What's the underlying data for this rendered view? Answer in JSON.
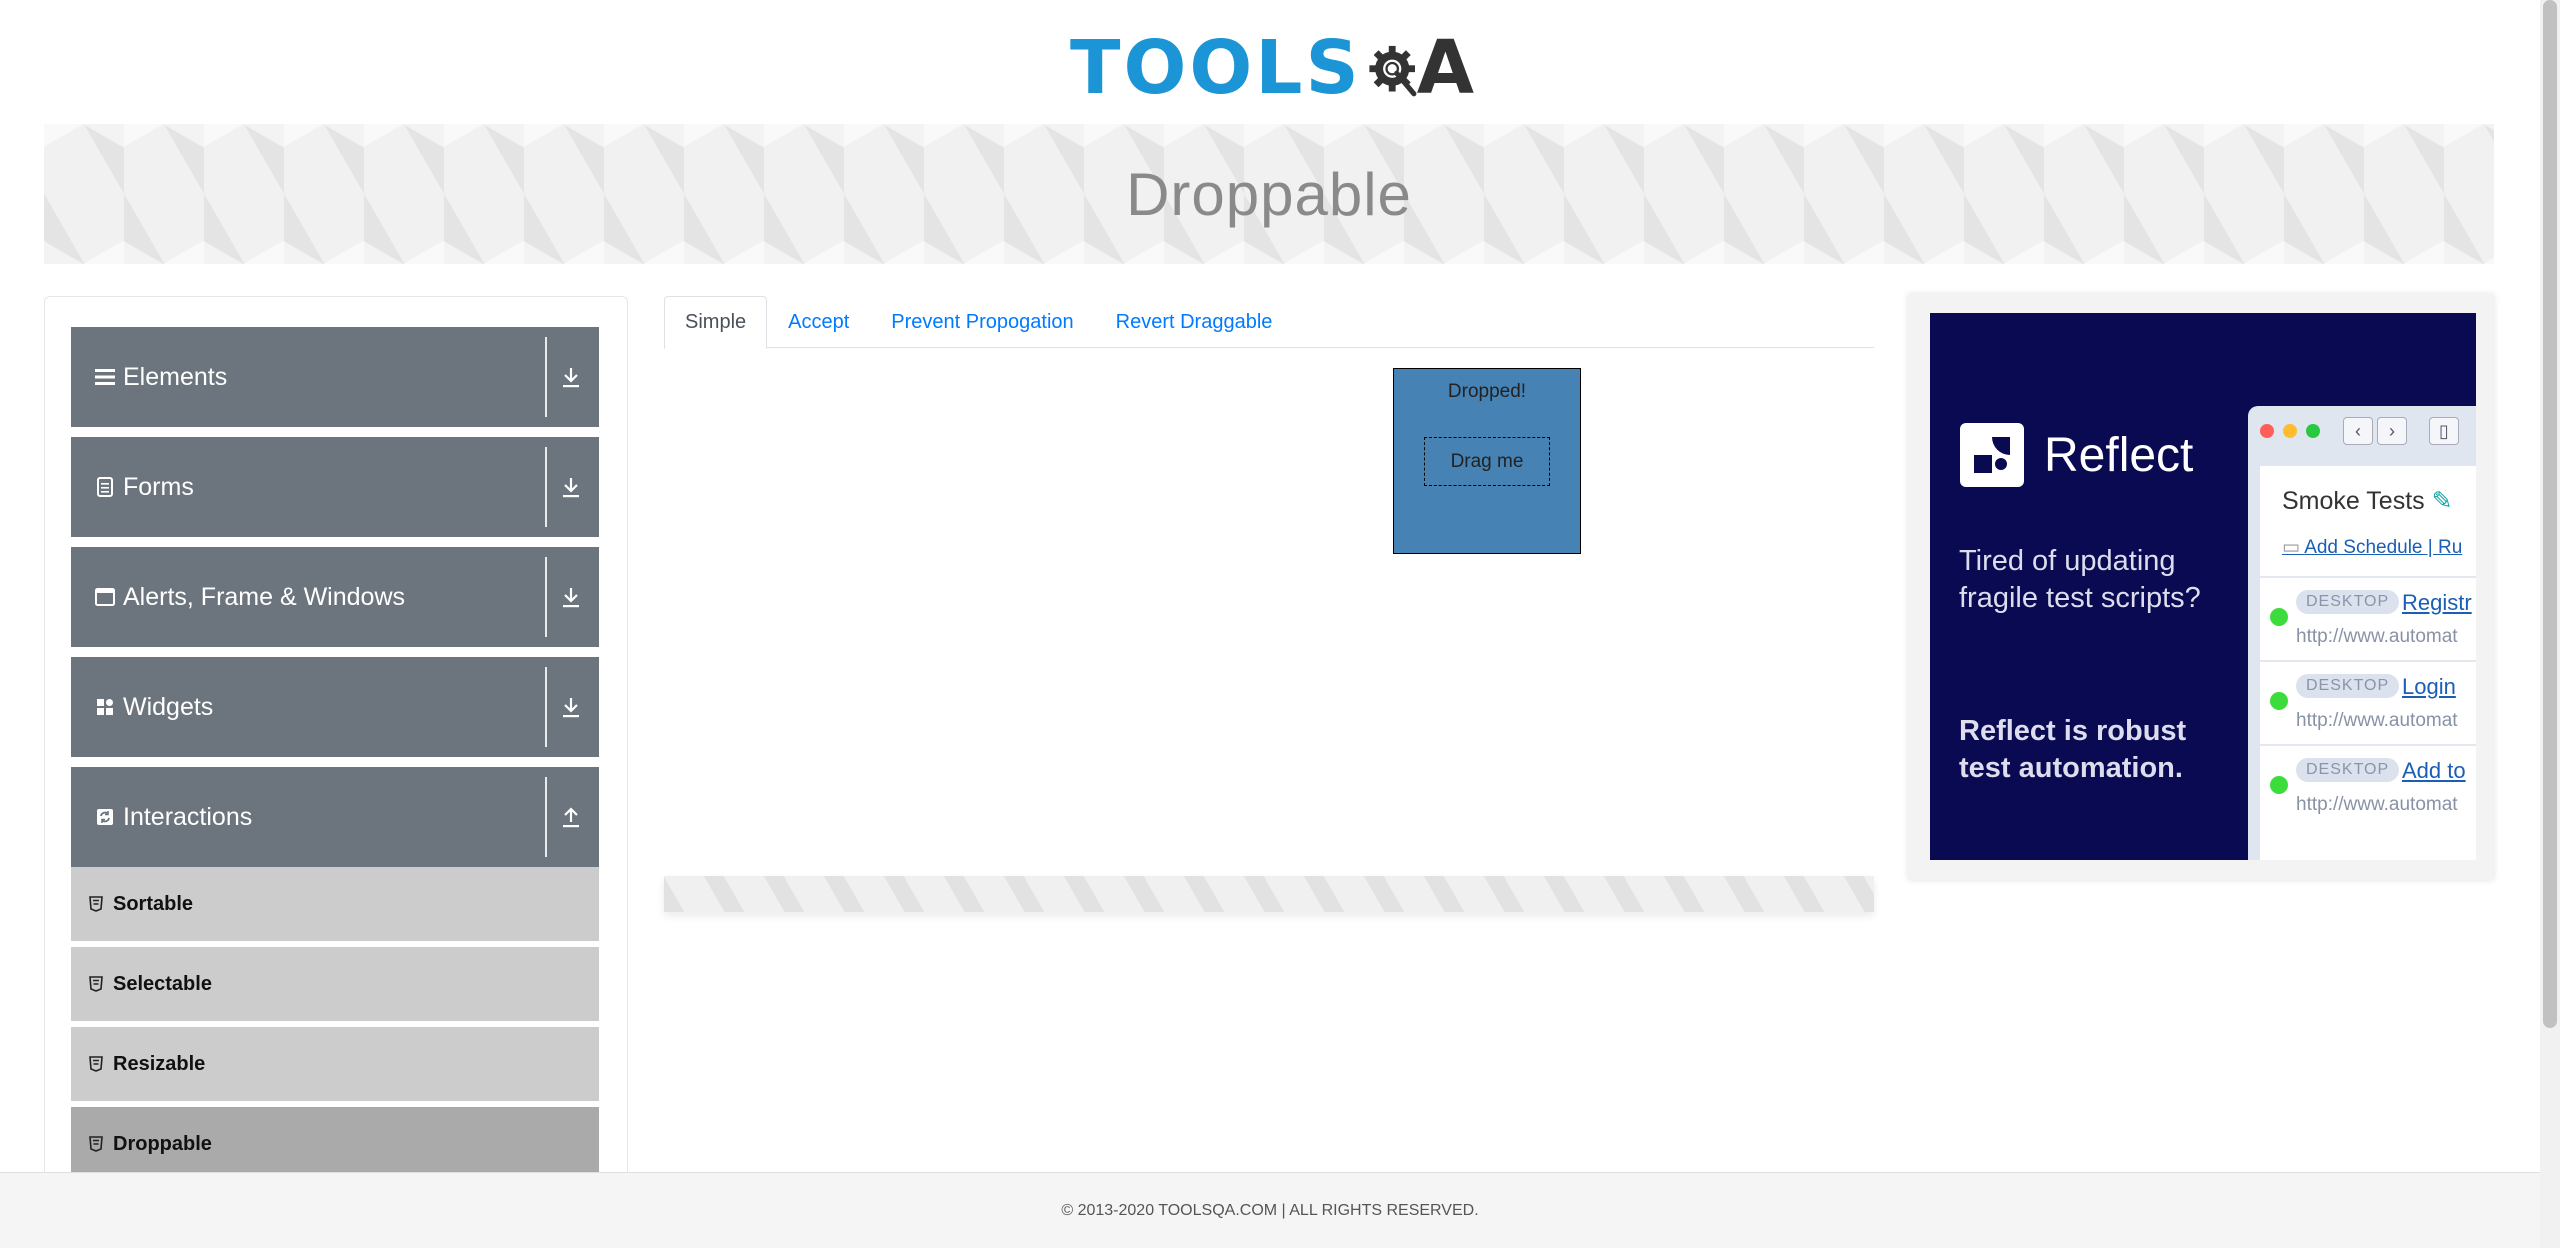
{
  "header": {
    "logo_text_left": "TOOLS",
    "logo_text_right": "A",
    "page_title": "Droppable"
  },
  "sidebar": {
    "groups": [
      {
        "label": "Elements",
        "icon": "hamburger-icon",
        "expanded": false
      },
      {
        "label": "Forms",
        "icon": "document-icon",
        "expanded": false
      },
      {
        "label": "Alerts, Frame & Windows",
        "icon": "window-icon",
        "expanded": false
      },
      {
        "label": "Widgets",
        "icon": "widgets-icon",
        "expanded": false
      },
      {
        "label": "Interactions",
        "icon": "refresh-icon",
        "expanded": true
      }
    ],
    "interaction_items": [
      {
        "label": "Sortable",
        "active": false
      },
      {
        "label": "Selectable",
        "active": false
      },
      {
        "label": "Resizable",
        "active": false
      },
      {
        "label": "Droppable",
        "active": true
      }
    ]
  },
  "tabs": [
    {
      "label": "Simple",
      "active": true
    },
    {
      "label": "Accept",
      "active": false
    },
    {
      "label": "Prevent Propogation",
      "active": false
    },
    {
      "label": "Revert Draggable",
      "active": false
    }
  ],
  "demo": {
    "drop_text": "Dropped!",
    "drag_text": "Drag me",
    "drop_color": "#4682b4"
  },
  "ad": {
    "brand": "Reflect",
    "headline": "Tired of updating fragile test scripts?",
    "tagline": "Reflect is robust test automation.",
    "mock_title": "Smoke Tests",
    "mock_links": "Add Schedule  |  Ru",
    "rows": [
      {
        "badge": "DESKTOP",
        "link": "Registr",
        "url": "http://www.automat"
      },
      {
        "badge": "DESKTOP",
        "link": "Login",
        "url": "http://www.automat"
      },
      {
        "badge": "DESKTOP",
        "link": "Add to",
        "url": "http://www.automat"
      }
    ]
  },
  "footer": {
    "text": "© 2013-2020 TOOLSQA.COM | ALL RIGHTS RESERVED."
  },
  "colors": {
    "brand_blue": "#1b95d6",
    "menu_gray": "#6c757d",
    "ad_navy": "#0a0a52",
    "link_blue": "#007bff"
  }
}
